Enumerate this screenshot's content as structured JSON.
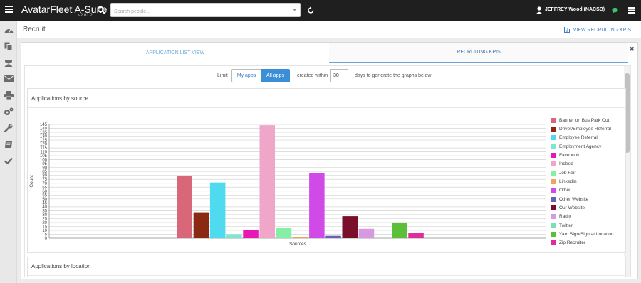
{
  "header": {
    "app_title": "AvatarFleet A-Suite",
    "version": "v2.61.2",
    "search_placeholder": "Search people...",
    "user_name": "JEFFREY Wood (NACSB)"
  },
  "sidebar": {
    "icons": [
      "dashboard-icon",
      "documents-icon",
      "people-icon",
      "mail-icon",
      "print-icon",
      "settings-icon",
      "wrench-icon",
      "book-icon",
      "check-icon"
    ]
  },
  "page": {
    "title": "Recruit",
    "kpi_link": "VIEW RECRUITING KPIS"
  },
  "tabs": [
    {
      "label": "APPLICATION LIST VIEW",
      "active": false
    },
    {
      "label": "RECRUITING KPIS",
      "active": true
    }
  ],
  "filter": {
    "limit_label": "Limit",
    "my_apps": "My apps",
    "all_apps": "All apps",
    "created_label": "created within",
    "days_value": "30",
    "days_label": "days to generate the graphs below"
  },
  "cards": {
    "by_source_title": "Applications by source",
    "by_location_title": "Applications by location"
  },
  "chart_data": {
    "type": "bar",
    "title": "Applications by source",
    "xlabel": "Sources",
    "ylabel": "Count",
    "ylim": [
      0,
      145
    ],
    "ytick_step": 5,
    "grid": true,
    "legend_position": "right",
    "series": [
      {
        "name": "Banner on Bus Park Out",
        "value": 79,
        "color": "#d9677a"
      },
      {
        "name": "Driver/Employee Referral",
        "value": 33,
        "color": "#8b2a12"
      },
      {
        "name": "Employee Referral",
        "value": 71,
        "color": "#4fdaf0"
      },
      {
        "name": "Employment Agency",
        "value": 5,
        "color": "#7de8d0"
      },
      {
        "name": "Facebook",
        "value": 10,
        "color": "#e619b4"
      },
      {
        "name": "Indeed",
        "value": 144,
        "color": "#f0a6c8"
      },
      {
        "name": "Job Fair",
        "value": 13,
        "color": "#86efa6"
      },
      {
        "name": "LinkedIn",
        "value": 1,
        "color": "#f0a45a"
      },
      {
        "name": "Other",
        "value": 83,
        "color": "#d04ae8"
      },
      {
        "name": "Other Website",
        "value": 3,
        "color": "#6461b8"
      },
      {
        "name": "Our Website",
        "value": 28,
        "color": "#7a0f2c"
      },
      {
        "name": "Radio",
        "value": 12,
        "color": "#d79ae0"
      },
      {
        "name": "Twitter",
        "value": 0,
        "color": "#77e0b8"
      },
      {
        "name": "Yard Sign/Sign at Location",
        "value": 20,
        "color": "#5cbf3a"
      },
      {
        "name": "Zip Recruiter",
        "value": 7,
        "color": "#e02b9c"
      }
    ]
  }
}
